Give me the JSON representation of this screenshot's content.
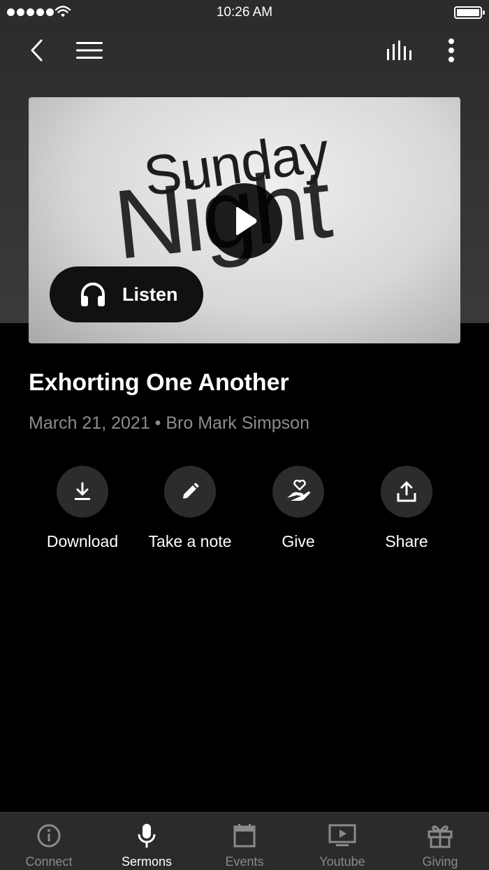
{
  "status_bar": {
    "time": "10:26 AM"
  },
  "media": {
    "artwork_line1": "Sunday",
    "artwork_line2": "Night",
    "listen_label": "Listen"
  },
  "sermon": {
    "title": "Exhorting One Another",
    "meta": "March 21, 2021 • Bro Mark Simpson"
  },
  "actions": [
    {
      "label": "Download",
      "icon": "download-icon"
    },
    {
      "label": "Take a note",
      "icon": "pencil-icon"
    },
    {
      "label": "Give",
      "icon": "heart-hand-icon"
    },
    {
      "label": "Share",
      "icon": "share-icon"
    }
  ],
  "tabs": [
    {
      "label": "Connect",
      "icon": "info-icon",
      "active": false
    },
    {
      "label": "Sermons",
      "icon": "microphone-icon",
      "active": true
    },
    {
      "label": "Events",
      "icon": "calendar-icon",
      "active": false
    },
    {
      "label": "Youtube",
      "icon": "tv-play-icon",
      "active": false
    },
    {
      "label": "Giving",
      "icon": "gift-icon",
      "active": false
    }
  ],
  "colors": {
    "background": "#000000",
    "header_gradient_top": "#2b2b2b",
    "tab_bar": "#2b2b2b",
    "action_circle": "#2c2c2c",
    "meta_text": "#8c8c8c",
    "inactive_tab": "#8a8a8a",
    "active_tab": "#ffffff"
  }
}
